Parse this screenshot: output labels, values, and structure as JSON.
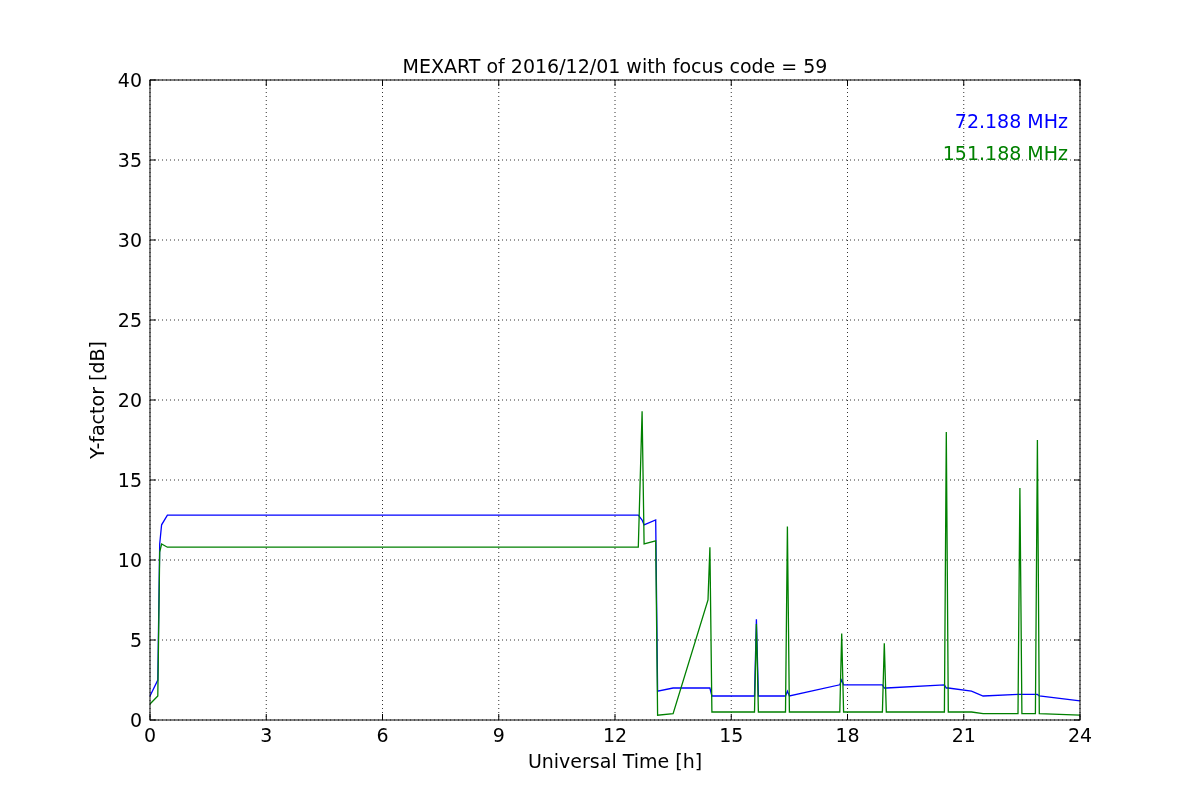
{
  "chart_data": {
    "type": "line",
    "title": "MEXART of 2016/12/01 with focus code = 59",
    "xlabel": "Universal Time [h]",
    "ylabel": "Y-factor [dB]",
    "x": [
      0,
      0.2,
      0.25,
      0.3,
      0.45,
      12.6,
      12.7,
      12.75,
      13.05,
      13.1,
      13.5,
      14.4,
      14.45,
      14.5,
      15.0,
      15.6,
      15.65,
      15.7,
      16.4,
      16.45,
      16.5,
      17.8,
      17.85,
      17.9,
      18.9,
      18.95,
      19.0,
      20.5,
      20.55,
      20.6,
      21.2,
      21.5,
      22.4,
      22.45,
      22.5,
      22.85,
      22.9,
      22.95,
      24
    ],
    "series": [
      {
        "name": "72.188 MHz",
        "color": "#0000ff",
        "values": [
          1.5,
          2.5,
          11,
          12.2,
          12.8,
          12.8,
          12.5,
          12.2,
          12.5,
          1.8,
          2.0,
          2.0,
          2.0,
          1.5,
          1.5,
          1.5,
          6.3,
          1.5,
          1.5,
          1.8,
          1.5,
          2.2,
          2.5,
          2.2,
          2.2,
          2.0,
          2.0,
          2.2,
          2.0,
          2.0,
          1.8,
          1.5,
          1.6,
          1.6,
          1.6,
          1.6,
          1.6,
          1.5,
          1.2
        ]
      },
      {
        "name": "151.188 MHz",
        "color": "#008000",
        "values": [
          1.0,
          1.5,
          10.5,
          11.0,
          10.8,
          10.8,
          19.3,
          11.0,
          11.2,
          0.3,
          0.4,
          7.5,
          10.8,
          0.5,
          0.5,
          0.5,
          6.0,
          0.5,
          0.5,
          12.1,
          0.5,
          0.5,
          5.4,
          0.5,
          0.5,
          4.8,
          0.5,
          0.5,
          18.0,
          0.5,
          0.5,
          0.4,
          0.4,
          14.5,
          0.4,
          0.4,
          17.5,
          0.4,
          0.3
        ]
      }
    ],
    "xlim": [
      0,
      24
    ],
    "ylim": [
      0,
      40
    ],
    "xticks": [
      0,
      3,
      6,
      9,
      12,
      15,
      18,
      21,
      24
    ],
    "yticks": [
      0,
      5,
      10,
      15,
      20,
      25,
      30,
      35,
      40
    ],
    "grid": true
  }
}
